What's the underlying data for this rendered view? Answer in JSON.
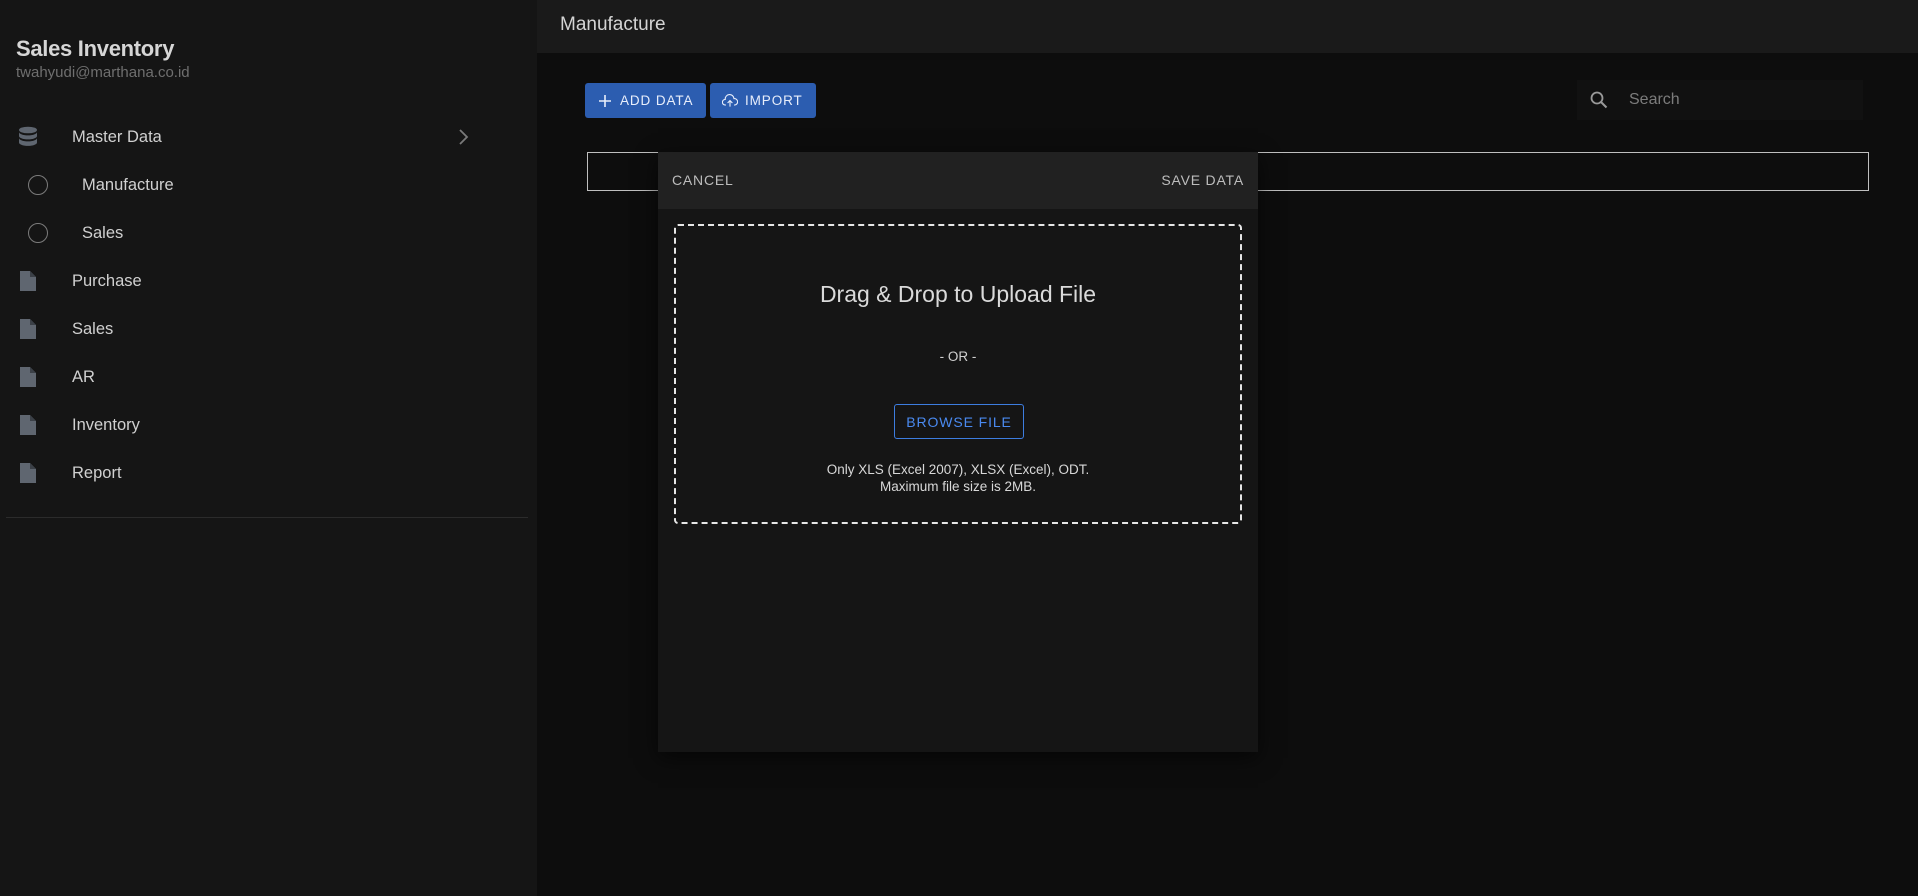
{
  "app": {
    "title": "Sales Inventory",
    "user_email": "twahyudi@marthana.co.id"
  },
  "sidebar": {
    "items": [
      {
        "label": "Master Data",
        "icon": "database-icon"
      },
      {
        "label": "Manufacture",
        "icon": "circle-icon"
      },
      {
        "label": "Sales",
        "icon": "circle-icon"
      },
      {
        "label": "Purchase",
        "icon": "file-icon"
      },
      {
        "label": "Sales",
        "icon": "file-icon"
      },
      {
        "label": "AR",
        "icon": "file-icon"
      },
      {
        "label": "Inventory",
        "icon": "file-icon"
      },
      {
        "label": "Report",
        "icon": "file-icon"
      }
    ]
  },
  "header": {
    "title": "Manufacture"
  },
  "toolbar": {
    "add_label": "ADD DATA",
    "import_label": "IMPORT"
  },
  "search": {
    "placeholder": "Search",
    "value": ""
  },
  "dialog": {
    "cancel_label": "CANCEL",
    "save_label": "SAVE DATA",
    "dropzone": {
      "title": "Drag & Drop to Upload File",
      "or_text": "- OR -",
      "browse_label": "BROWSE FILE",
      "note_formats": "Only XLS (Excel 2007), XLSX (Excel), ODT.",
      "note_size": "Maximum file size is 2MB."
    }
  },
  "colors": {
    "primary": "#2c5db0",
    "accent_outline": "#3d7de0",
    "sidebar_bg": "#151515",
    "page_bg": "#0d0d0d"
  }
}
